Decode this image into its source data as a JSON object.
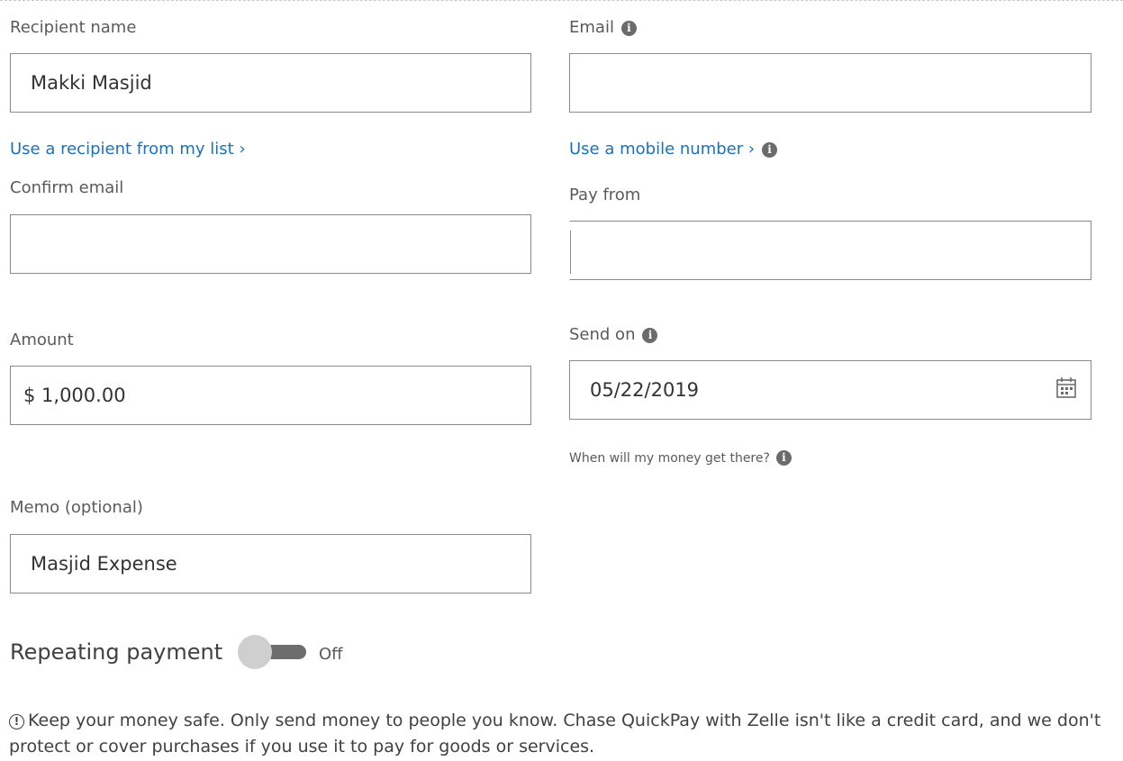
{
  "recipient_name": {
    "label": "Recipient name",
    "value": "Makki Masjid",
    "link": "Use a recipient from my list ›"
  },
  "email": {
    "label": "Email",
    "value": "",
    "link": "Use a mobile number ›"
  },
  "confirm_email": {
    "label": "Confirm email",
    "value": ""
  },
  "pay_from": {
    "label": "Pay from",
    "value": ""
  },
  "amount": {
    "label": "Amount",
    "value": "$  1,000.00"
  },
  "send_on": {
    "label": "Send on",
    "value": "05/22/2019",
    "delivery_link": "When will my money get there?"
  },
  "memo": {
    "label": "Memo (optional)",
    "value": "Masjid Expense"
  },
  "repeating_payment": {
    "label": "Repeating payment",
    "state": "Off"
  },
  "warning": {
    "icon": "!",
    "text": "Keep your money safe. Only send money to people you know. Chase QuickPay with Zelle isn't like a credit card, and we don't protect or cover purchases if you use it to pay for goods or services."
  },
  "icons": {
    "info": "i",
    "calendar": "calendar-icon"
  },
  "colors": {
    "link": "#1872c1",
    "text": "#414042",
    "label": "#5a5a5a",
    "border": "#8a8a8a",
    "toggle_track": "#6d6d6d",
    "toggle_knob": "#cfcfcf"
  }
}
